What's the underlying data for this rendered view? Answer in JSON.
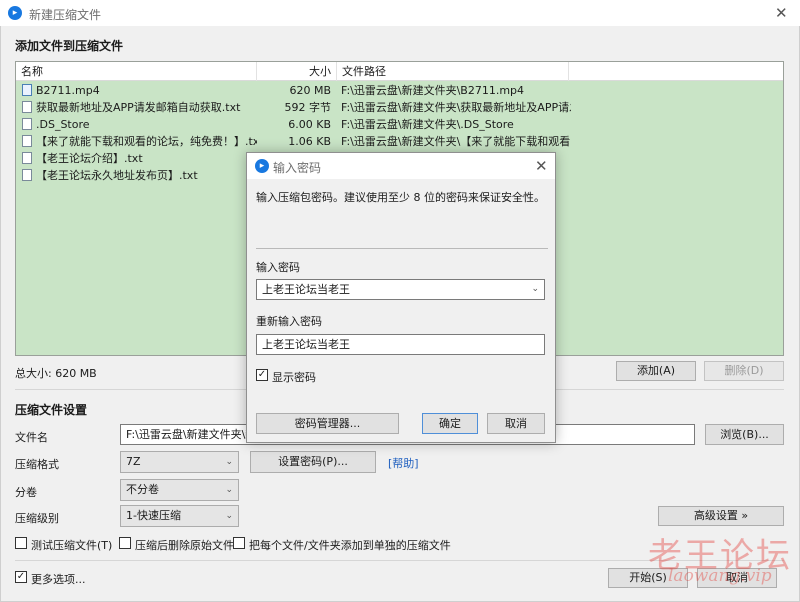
{
  "window": {
    "title": "新建压缩文件"
  },
  "add_section": {
    "title": "添加文件到压缩文件"
  },
  "file_list": {
    "columns": [
      "名称",
      "大小",
      "文件路径"
    ],
    "rows": [
      {
        "name": "B2711.mp4",
        "size": "620 MB",
        "path": "F:\\迅雷云盘\\新建文件夹\\B2711.mp4",
        "icon": "video-file-icon"
      },
      {
        "name": "获取最新地址及APP请发邮箱自动获取.txt",
        "size": "592 字节",
        "path": "F:\\迅雷云盘\\新建文件夹\\获取最新地址及APP请发...",
        "icon": "text-file-icon"
      },
      {
        "name": ".DS_Store",
        "size": "6.00 KB",
        "path": "F:\\迅雷云盘\\新建文件夹\\.DS_Store",
        "icon": "file-icon"
      },
      {
        "name": "【来了就能下载和观看的论坛，纯免费！】.txt",
        "size": "1.06 KB",
        "path": "F:\\迅雷云盘\\新建文件夹\\【来了就能下载和观看的...",
        "icon": "text-file-icon"
      },
      {
        "name": "【老王论坛介绍】.txt",
        "size": "",
        "path": "",
        "icon": "text-file-icon"
      },
      {
        "name": "【老王论坛永久地址发布页】.txt",
        "size": "",
        "path": "",
        "icon": "text-file-icon"
      }
    ]
  },
  "total_size": "总大小: 620 MB",
  "buttons": {
    "add": "添加(A)",
    "delete": "删除(D)",
    "browse": "浏览(B)...",
    "set_password": "设置密码(P)...",
    "advanced": "高级设置 »",
    "start": "开始(S)",
    "cancel": "取消"
  },
  "settings": {
    "title": "压缩文件设置",
    "filename_label": "文件名",
    "filename_value": "F:\\迅雷云盘\\新建文件夹\\新建",
    "format_label": "压缩格式",
    "format_value": "7Z",
    "split_label": "分卷",
    "split_value": "不分卷",
    "level_label": "压缩级别",
    "level_value": "1-快速压缩",
    "help_link": "[帮助]"
  },
  "options": [
    {
      "label": "测试压缩文件(T)",
      "checked": false
    },
    {
      "label": "压缩后删除原始文件",
      "checked": false
    },
    {
      "label": "把每个文件/文件夹添加到单独的压缩文件",
      "checked": false
    }
  ],
  "more_options": {
    "label": "更多选项...",
    "checked": true
  },
  "dialog": {
    "title": "输入密码",
    "description": "输入压缩包密码。建议使用至少 8 位的密码来保证安全性。",
    "password_label": "输入密码",
    "password_value": "上老王论坛当老王",
    "repeat_label": "重新输入密码",
    "repeat_value": "上老王论坛当老王",
    "show_password": {
      "label": "显示密码",
      "checked": true
    },
    "buttons": {
      "manager": "密码管理器...",
      "ok": "确定",
      "cancel": "取消"
    }
  },
  "watermark": {
    "text": "老王论坛",
    "url": "laowang.vip"
  },
  "colors": {
    "list_bg": "#c9e4c6",
    "accent": "#1878e0",
    "link": "#1f5fbf",
    "watermark": "#e4352f"
  }
}
